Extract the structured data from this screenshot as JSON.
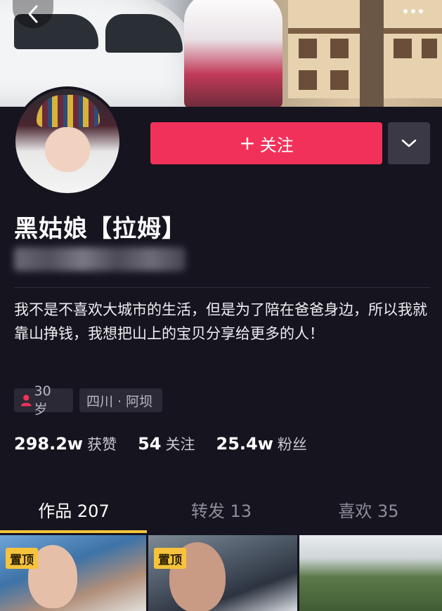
{
  "header": {
    "back_icon": "chevron-left-icon",
    "more_icon": "more-dots-icon"
  },
  "profile": {
    "name": "黑姑娘【拉姆】",
    "follow_label": "关注",
    "follow_plus": "+",
    "dropdown_icon": "chevron-down-icon",
    "bio": "我不是不喜欢大城市的生活，但是为了陪在爸爸身边，所以我就靠山挣钱，我想把山上的宝贝分享给更多的人！",
    "age_tag": "30 岁",
    "location_tag": "四川 · 阿坝"
  },
  "stats": [
    {
      "value": "298.2w",
      "label": "获赞"
    },
    {
      "value": "54",
      "label": "关注"
    },
    {
      "value": "25.4w",
      "label": "粉丝"
    }
  ],
  "tabs": [
    {
      "label": "作品 207",
      "active": true
    },
    {
      "label": "转发 13",
      "active": false
    },
    {
      "label": "喜欢 35",
      "active": false
    }
  ],
  "videos": [
    {
      "pinned_label": "置顶"
    },
    {
      "pinned_label": "置顶"
    },
    {
      "pinned_label": ""
    }
  ],
  "colors": {
    "background": "#15141f",
    "follow_button": "#f2315a",
    "accent_tab": "#f6c33b"
  }
}
